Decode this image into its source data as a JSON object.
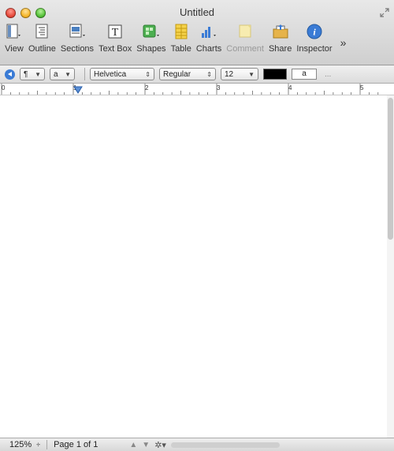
{
  "window": {
    "title": "Untitled"
  },
  "toolbar": {
    "items": [
      {
        "label": "View",
        "icon": "view-icon"
      },
      {
        "label": "Outline",
        "icon": "outline-icon"
      },
      {
        "label": "Sections",
        "icon": "sections-icon"
      },
      {
        "label": "Text Box",
        "icon": "text-box-icon"
      },
      {
        "label": "Shapes",
        "icon": "shapes-icon"
      },
      {
        "label": "Table",
        "icon": "table-icon"
      },
      {
        "label": "Charts",
        "icon": "charts-icon"
      },
      {
        "label": "Comment",
        "icon": "comment-icon",
        "disabled": true
      },
      {
        "label": "Share",
        "icon": "share-icon"
      },
      {
        "label": "Inspector",
        "icon": "inspector-icon"
      }
    ],
    "overflow": "»"
  },
  "formatbar": {
    "paragraph_style": "¶",
    "char_style": "a",
    "font": "Helvetica",
    "typeface": "Regular",
    "size": "12",
    "char_fill": "a",
    "more": "...",
    "text_color": "#000000"
  },
  "ruler": {
    "labels": [
      "0",
      "1",
      "2",
      "3",
      "4",
      "5"
    ]
  },
  "status": {
    "zoom": "125%",
    "zoom_arrows": "÷",
    "page": "Page 1 of 1"
  },
  "colors": {
    "accent": "#3a7bd5"
  }
}
